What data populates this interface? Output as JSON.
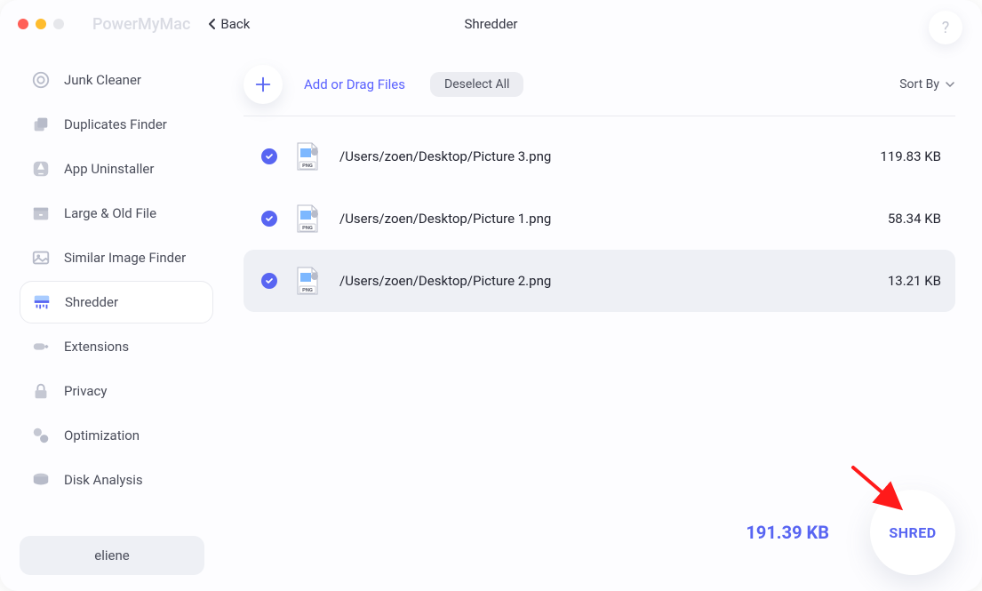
{
  "app_name": "PowerMyMac",
  "back_label": "Back",
  "header_title": "Shredder",
  "help_label": "?",
  "sidebar": {
    "items": [
      {
        "label": "Junk Cleaner",
        "active": false
      },
      {
        "label": "Duplicates Finder",
        "active": false
      },
      {
        "label": "App Uninstaller",
        "active": false
      },
      {
        "label": "Large & Old File",
        "active": false
      },
      {
        "label": "Similar Image Finder",
        "active": false
      },
      {
        "label": "Shredder",
        "active": true
      },
      {
        "label": "Extensions",
        "active": false
      },
      {
        "label": "Privacy",
        "active": false
      },
      {
        "label": "Optimization",
        "active": false
      },
      {
        "label": "Disk Analysis",
        "active": false
      }
    ],
    "user": "eliene"
  },
  "toolbar": {
    "add_label": "Add or Drag Files",
    "deselect_label": "Deselect All",
    "sort_label": "Sort By"
  },
  "files": [
    {
      "path": "/Users/zoen/Desktop/Picture 3.png",
      "size": "119.83 KB",
      "highlight": false
    },
    {
      "path": "/Users/zoen/Desktop/Picture 1.png",
      "size": "58.34 KB",
      "highlight": false
    },
    {
      "path": "/Users/zoen/Desktop/Picture 2.png",
      "size": "13.21 KB",
      "highlight": true
    }
  ],
  "total_size": "191.39 KB",
  "shred_label": "SHRED"
}
